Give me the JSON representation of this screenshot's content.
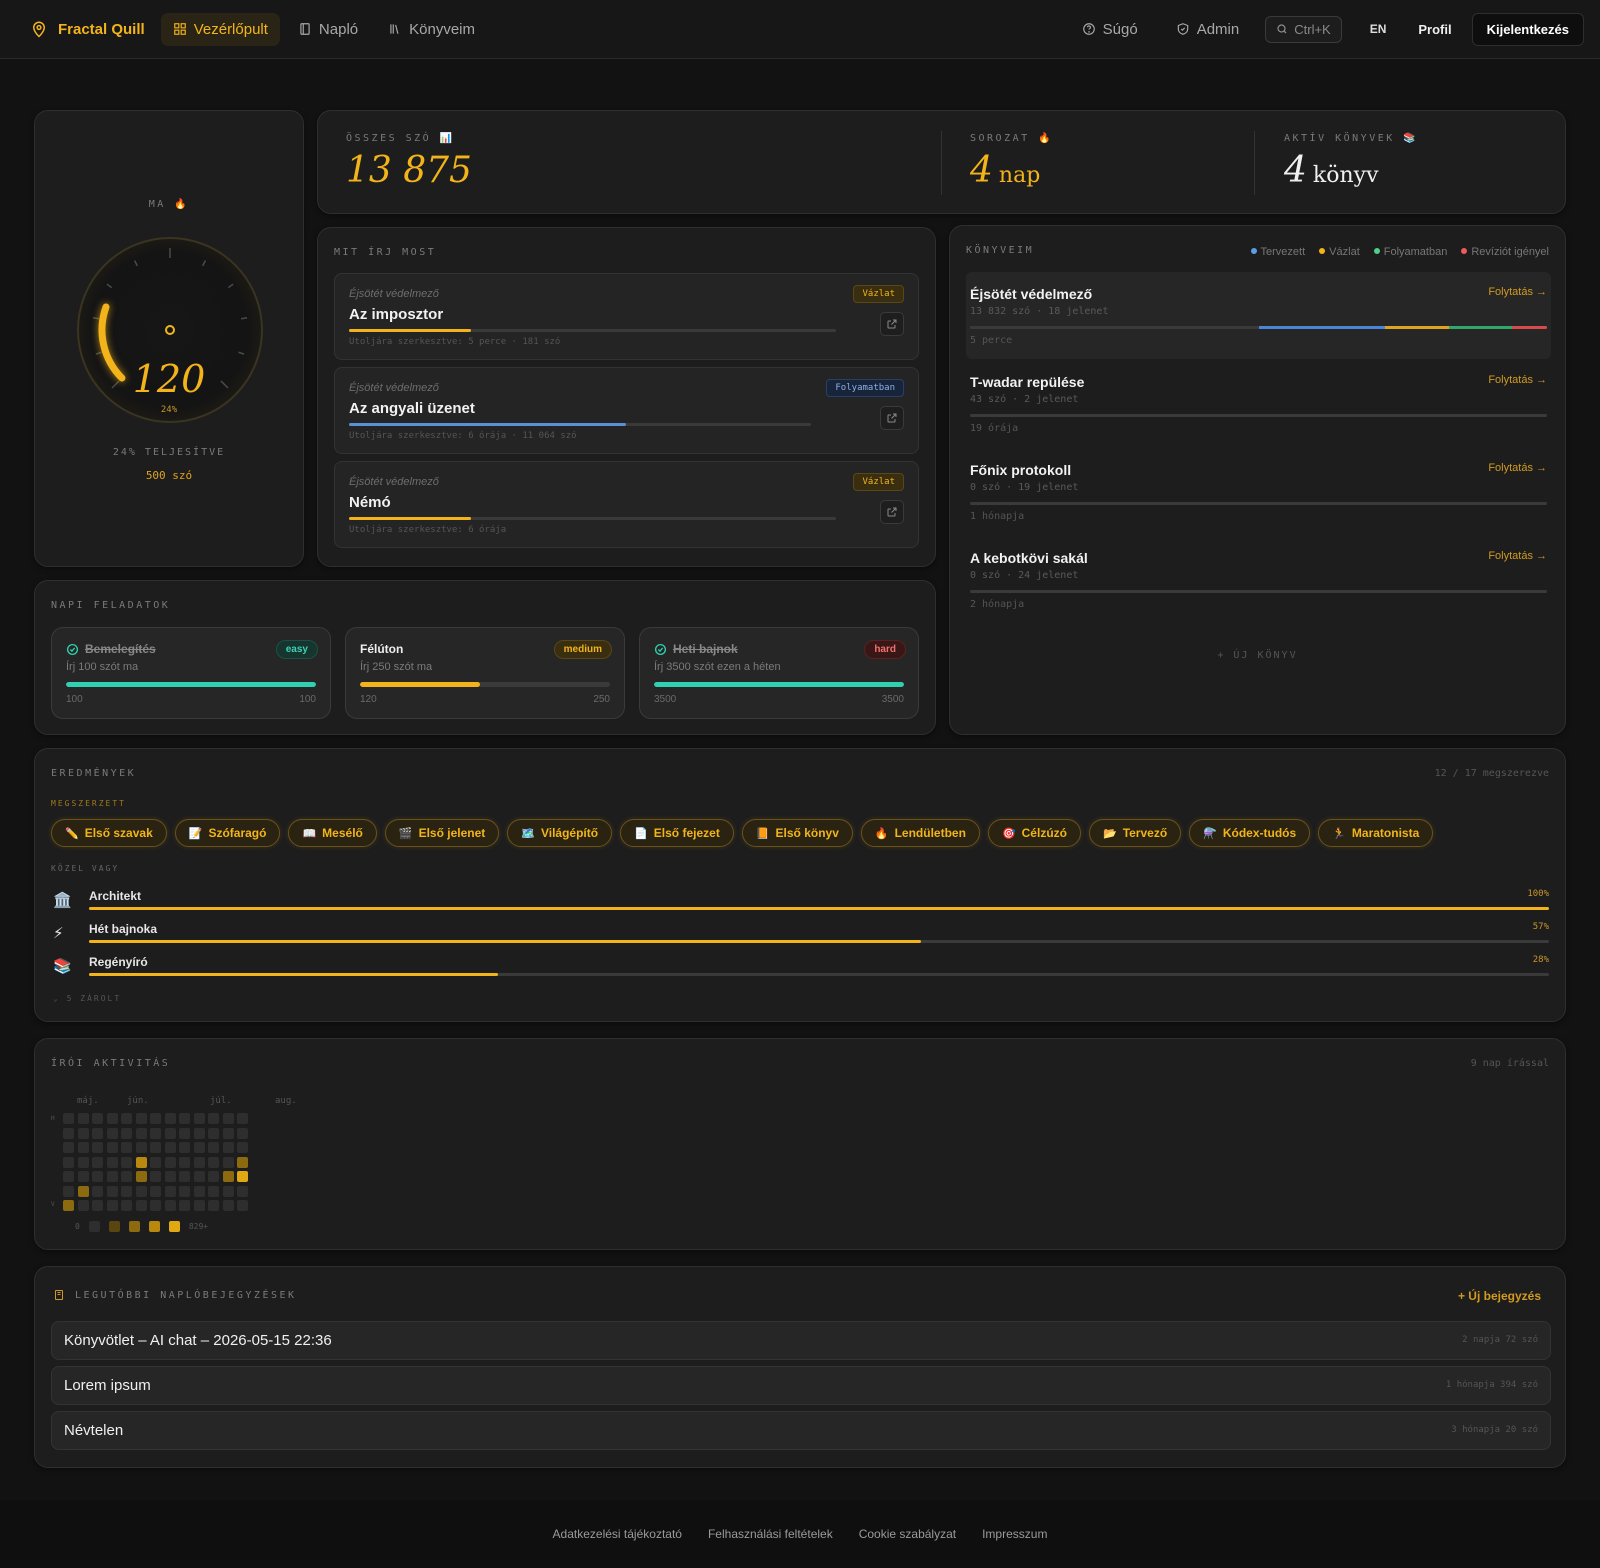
{
  "nav": {
    "brand": "Fractal Quill",
    "items": [
      {
        "label": "Vezérlőpult",
        "active": true
      },
      {
        "label": "Napló",
        "active": false
      },
      {
        "label": "Könyveim",
        "active": false
      }
    ],
    "help": "Súgó",
    "admin": "Admin",
    "search_shortcut": "Ctrl+K",
    "lang": "EN",
    "profile": "Profil",
    "logout": "Kijelentkezés"
  },
  "today": {
    "label": "MA",
    "value": "120",
    "percent_text": "24%",
    "percent": 0.24,
    "done_text": "24% TELJESÍTVE",
    "target_text": "500 szó"
  },
  "stats": {
    "total_label": "ÖSSZES SZÓ",
    "total_value": "13 875",
    "streak_label": "SOROZAT",
    "streak_value": "4",
    "streak_unit": "nap",
    "active_label": "AKTÍV KÖNYVEK",
    "active_value": "4",
    "active_unit": "könyv"
  },
  "writing_now": {
    "label": "MIT ÍRJ MOST",
    "items": [
      {
        "series": "Éjsötét védelmező",
        "title": "Az imposztor",
        "badge": "Vázlat",
        "badge_type": "draft",
        "progress": 0.25,
        "color": "#f2b41a",
        "meta": "Utoljára szerkesztve: 5 perce · 181 szó"
      },
      {
        "series": "Éjsötét védelmező",
        "title": "Az angyali üzenet",
        "badge": "Folyamatban",
        "badge_type": "prog",
        "progress": 0.6,
        "color": "#5b8fd6",
        "meta": "Utoljára szerkesztve: 6 órája · 11 064 szó"
      },
      {
        "series": "Éjsötét védelmező",
        "title": "Némó",
        "badge": "Vázlat",
        "badge_type": "draft",
        "progress": 0.25,
        "color": "#f2b41a",
        "meta": "Utoljára szerkesztve: 6 órája"
      }
    ]
  },
  "books": {
    "label": "KÖNYVEIM",
    "legend": [
      {
        "label": "Tervezett",
        "color": "#5b9ee8"
      },
      {
        "label": "Vázlat",
        "color": "#f2b41a"
      },
      {
        "label": "Folyamatban",
        "color": "#4fcf8a"
      },
      {
        "label": "Revíziót igényel",
        "color": "#ef5a5a"
      }
    ],
    "continue_label": "Folytatás →",
    "items": [
      {
        "name": "Éjsötét védelmező",
        "sub": "13 832 szó · 18 jelenet",
        "when": "5 perce",
        "selected": true,
        "segments": [
          {
            "w": 0.5,
            "c": "#3a3a3a"
          },
          {
            "w": 0.22,
            "c": "#4a86d8"
          },
          {
            "w": 0.11,
            "c": "#e0a320"
          },
          {
            "w": 0.11,
            "c": "#2fa86a"
          },
          {
            "w": 0.06,
            "c": "#d84a4a"
          }
        ]
      },
      {
        "name": "T-wadar repülése",
        "sub": "43 szó · 2 jelenet",
        "when": "19 órája",
        "selected": false,
        "segments": []
      },
      {
        "name": "Főnix protokoll",
        "sub": "0 szó · 19 jelenet",
        "when": "1 hónapja",
        "selected": false,
        "segments": []
      },
      {
        "name": "A kebotkövi sakál",
        "sub": "0 szó · 24 jelenet",
        "when": "2 hónapja",
        "selected": false,
        "segments": []
      }
    ],
    "new_book": "+ ÚJ KÖNYV"
  },
  "daily": {
    "label": "NAPI FELADATOK",
    "quests": [
      {
        "title": "Bemelegítés",
        "desc": "Írj 100 szót ma",
        "diff": "easy",
        "done": true,
        "progress": 1.0,
        "min": "100",
        "max": "100",
        "color": "#2fd1b0"
      },
      {
        "title": "Félúton",
        "desc": "Írj 250 szót ma",
        "diff": "medium",
        "done": false,
        "progress": 0.48,
        "min": "120",
        "max": "250",
        "color": "#f2b41a"
      },
      {
        "title": "Heti bajnok",
        "desc": "Írj 3500 szót ezen a héten",
        "diff": "hard",
        "done": true,
        "progress": 1.0,
        "min": "3500",
        "max": "3500",
        "color": "#2fd1b0"
      }
    ]
  },
  "achievements": {
    "label": "EREDMÉNYEK",
    "count": "12 / 17 megszerezve",
    "earned_label": "MEGSZERZETT",
    "earned": [
      {
        "icon": "✏️",
        "label": "Első szavak"
      },
      {
        "icon": "📝",
        "label": "Szófaragó"
      },
      {
        "icon": "📖",
        "label": "Mesélő"
      },
      {
        "icon": "🎬",
        "label": "Első jelenet"
      },
      {
        "icon": "🗺️",
        "label": "Világépítő"
      },
      {
        "icon": "📄",
        "label": "Első fejezet"
      },
      {
        "icon": "📙",
        "label": "Első könyv"
      },
      {
        "icon": "🔥",
        "label": "Lendületben"
      },
      {
        "icon": "🎯",
        "label": "Célzúzó"
      },
      {
        "icon": "📂",
        "label": "Tervező"
      },
      {
        "icon": "⚗️",
        "label": "Kódex-tudós"
      },
      {
        "icon": "🏃",
        "label": "Maratonista"
      }
    ],
    "near_label": "KÖZEL VAGY",
    "near": [
      {
        "icon": "🏛️",
        "label": "Architekt",
        "pct": "100%",
        "progress": 1.0
      },
      {
        "icon": "⚡",
        "label": "Hét bajnoka",
        "pct": "57%",
        "progress": 0.57
      },
      {
        "icon": "📚",
        "label": "Regényíró",
        "pct": "28%",
        "progress": 0.28
      }
    ],
    "locked": "⌄ 5 ZÁROLT"
  },
  "activity": {
    "label": "ÍRÓI AKTIVITÁS",
    "count": "9 nap írással",
    "months": [
      "máj.",
      "jún.",
      "júl.",
      "aug."
    ],
    "day_labels": [
      "H",
      "",
      "",
      "",
      "",
      "",
      "V"
    ],
    "legend_min": "0",
    "legend_max": "829+",
    "levels": [
      "#2e2e2e",
      "#5a4410",
      "#8c6a10",
      "#b8890e",
      "#e0a812"
    ],
    "weeks": 13,
    "active_cells": [
      {
        "w": 5,
        "d": 3,
        "l": 3
      },
      {
        "w": 5,
        "d": 4,
        "l": 2
      },
      {
        "w": 1,
        "d": 5,
        "l": 2
      },
      {
        "w": 0,
        "d": 6,
        "l": 2
      },
      {
        "w": 12,
        "d": 3,
        "l": 2
      },
      {
        "w": 12,
        "d": 4,
        "l": 4
      },
      {
        "w": 11,
        "d": 4,
        "l": 2
      }
    ]
  },
  "journal": {
    "label": "LEGUTÓBBI NAPLÓBEJEGYZÉSEK",
    "new_entry": "+ Új bejegyzés",
    "entries": [
      {
        "title": "Könyvötlet – AI chat – 2026-05-15 22:36",
        "meta": "2 napja  72 szó"
      },
      {
        "title": "Lorem ipsum",
        "meta": "1 hónapja  394 szó"
      },
      {
        "title": "Névtelen",
        "meta": "3 hónapja  20 szó"
      }
    ]
  },
  "footer": [
    "Adatkezelési tájékoztató",
    "Felhasználási feltételek",
    "Cookie szabályzat",
    "Impresszum"
  ]
}
